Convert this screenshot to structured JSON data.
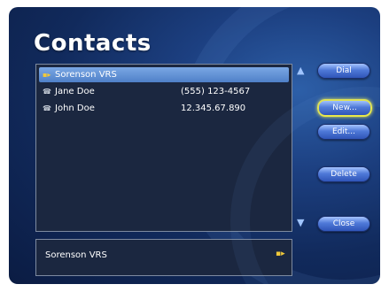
{
  "window": {
    "title": "Contacts"
  },
  "contacts": [
    {
      "name": "Sorenson VRS",
      "number": "",
      "icon": "vrs-icon"
    },
    {
      "name": "Jane Doe",
      "number": "(555) 123-4567",
      "icon": "phone-icon"
    },
    {
      "name": "John Doe",
      "number": "12.345.67.890",
      "icon": "phone-icon"
    }
  ],
  "selected_index": 0,
  "detail": {
    "name": "Sorenson VRS",
    "icon": "vrs-icon"
  },
  "buttons": {
    "dial": "Dial",
    "new": "New...",
    "edit": "Edit...",
    "delete": "Delete",
    "close": "Close"
  },
  "focused_button": "new",
  "colors": {
    "selection": "#5f8ed3",
    "focus_ring": "#e8e84a",
    "button": "#4f79d8",
    "list_bg": "#1b2740"
  }
}
